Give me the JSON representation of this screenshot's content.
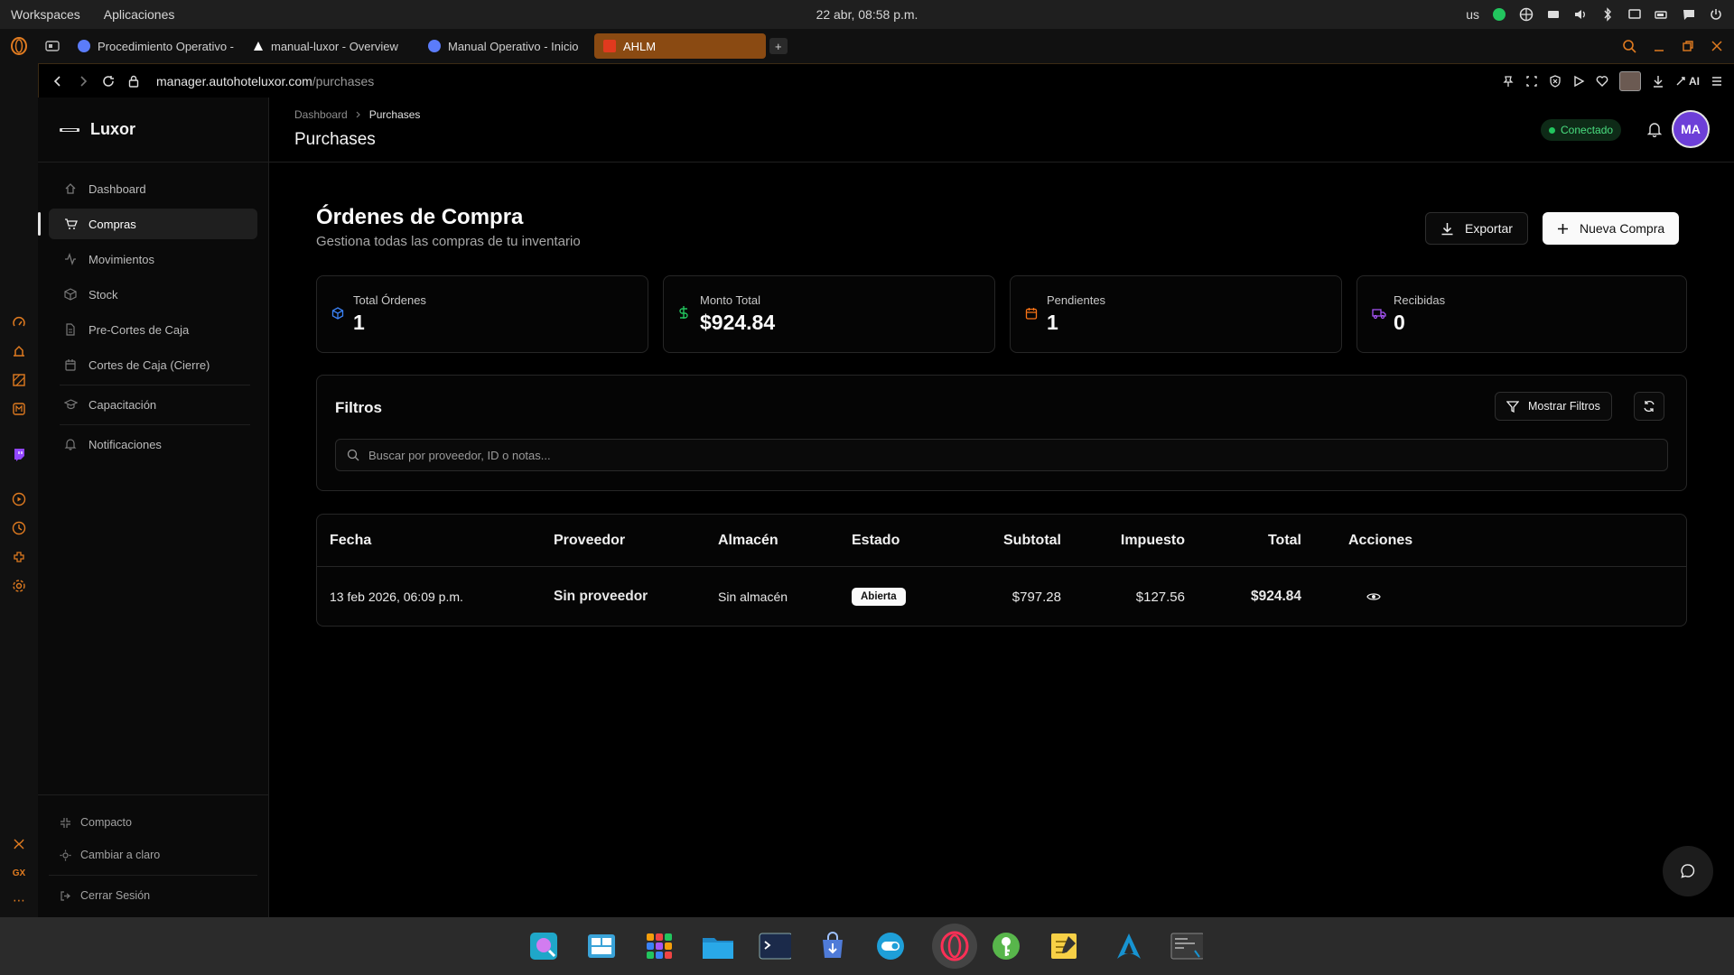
{
  "system": {
    "menu": [
      "Workspaces",
      "Aplicaciones"
    ],
    "clock": "22 abr, 08:58 p.m.",
    "keyboard": "us"
  },
  "browser": {
    "tabs": [
      {
        "label": "Procedimiento Operativo -",
        "color": "#5b7cfa"
      },
      {
        "label": "manual-luxor - Overview",
        "color": "#ffffff"
      },
      {
        "label": "Manual Operativo - Inicio",
        "color": "#5b7cfa"
      },
      {
        "label": "AHLM",
        "color": "#e03a1e"
      }
    ],
    "new_tab": "+",
    "url_host": "manager.autohoteluxor.com",
    "url_path": "/purchases",
    "ai_label": "AI"
  },
  "sidebar": {
    "brand": "Luxor",
    "items": [
      {
        "label": "Dashboard",
        "icon": "home-icon"
      },
      {
        "label": "Compras",
        "icon": "cart-icon"
      },
      {
        "label": "Movimientos",
        "icon": "activity-icon"
      },
      {
        "label": "Stock",
        "icon": "box-icon"
      },
      {
        "label": "Pre-Cortes de Caja",
        "icon": "file-icon"
      },
      {
        "label": "Cortes de Caja (Cierre)",
        "icon": "calendar-icon"
      },
      {
        "label": "Capacitación",
        "icon": "graduation-icon"
      },
      {
        "label": "Notificaciones",
        "icon": "bell-icon"
      }
    ],
    "bottom": [
      {
        "label": "Compacto",
        "icon": "minimize-icon"
      },
      {
        "label": "Cambiar a claro",
        "icon": "sun-icon"
      },
      {
        "label": "Cerrar Sesión",
        "icon": "logout-icon"
      }
    ]
  },
  "header": {
    "breadcrumb": [
      "Dashboard",
      "Purchases"
    ],
    "title": "Purchases",
    "status": "Conectado",
    "avatar": "MA"
  },
  "main": {
    "title": "Órdenes de Compra",
    "subtitle": "Gestiona todas las compras de tu inventario",
    "export_label": "Exportar",
    "new_label": "Nueva Compra",
    "stats": [
      {
        "label": "Total Órdenes",
        "value": "1",
        "icon": "cube-icon",
        "color": "#3b82f6"
      },
      {
        "label": "Monto Total",
        "value": "$924.84",
        "icon": "dollar-icon",
        "color": "#22c55e"
      },
      {
        "label": "Pendientes",
        "value": "1",
        "icon": "calendar-icon",
        "color": "#f97316"
      },
      {
        "label": "Recibidas",
        "value": "0",
        "icon": "truck-icon",
        "color": "#a855f7"
      }
    ],
    "filters": {
      "title": "Filtros",
      "show_label": "Mostrar Filtros",
      "search_placeholder": "Buscar por proveedor, ID o notas..."
    },
    "table": {
      "columns": [
        "Fecha",
        "Proveedor",
        "Almacén",
        "Estado",
        "Subtotal",
        "Impuesto",
        "Total",
        "Acciones"
      ],
      "rows": [
        {
          "fecha": "13 feb 2026, 06:09 p.m.",
          "proveedor": "Sin proveedor",
          "almacen": "Sin almacén",
          "estado": "Abierta",
          "subtotal": "$797.28",
          "impuesto": "$127.56",
          "total": "$924.84"
        }
      ]
    }
  },
  "colors": {
    "accent_tab": "#8a4a12",
    "status_green": "#22c55e",
    "avatar": "#6d3fd8"
  }
}
